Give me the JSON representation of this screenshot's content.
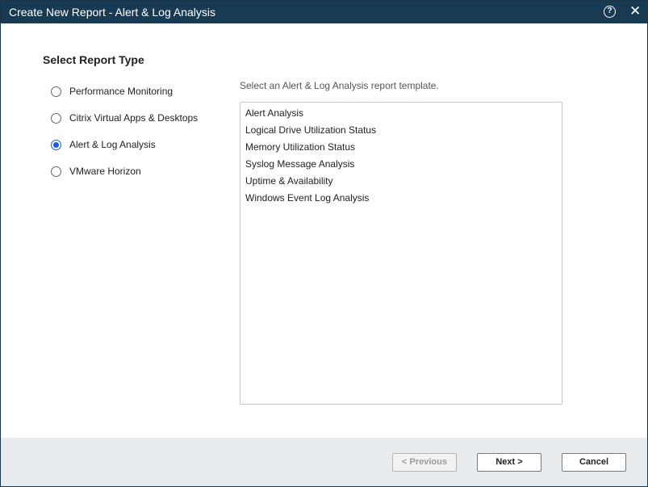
{
  "window": {
    "title": "Create New Report - Alert & Log Analysis",
    "help_icon": "?",
    "close_icon": "✕"
  },
  "section_heading": "Select Report Type",
  "report_types": [
    {
      "label": "Performance Monitoring",
      "selected": false
    },
    {
      "label": "Citrix Virtual Apps & Desktops",
      "selected": false
    },
    {
      "label": "Alert & Log Analysis",
      "selected": true
    },
    {
      "label": "VMware Horizon",
      "selected": false
    }
  ],
  "instruction": "Select an Alert & Log Analysis report template.",
  "templates": [
    "Alert Analysis",
    "Logical Drive Utilization Status",
    "Memory Utilization Status",
    "Syslog Message Analysis",
    "Uptime & Availability",
    "Windows Event Log Analysis"
  ],
  "buttons": {
    "previous": "< Previous",
    "next": "Next >",
    "cancel": "Cancel"
  },
  "colors": {
    "titlebar": "#183a52",
    "radio_selected": "#1a5fd0",
    "footer": "#e9ecef"
  }
}
